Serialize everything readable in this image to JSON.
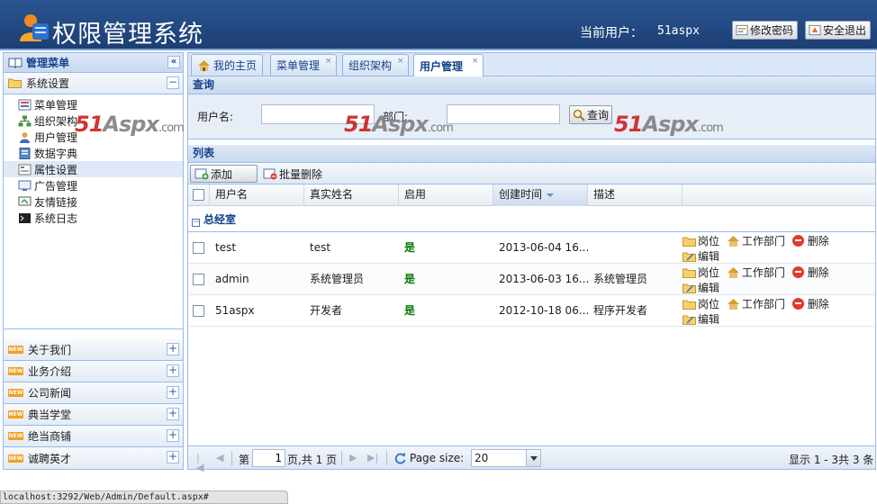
{
  "header": {
    "title": "权限管理系统",
    "current_user_label": "当前用户：",
    "current_user": "51aspx",
    "change_password": "修改密码",
    "logout": "安全退出"
  },
  "sidebar": {
    "title": "管理菜单",
    "collapse_symbol": "«",
    "expanded_group": "系统设置",
    "expanded_symbol": "−",
    "items": [
      {
        "label": "菜单管理",
        "icon": "menu-icon"
      },
      {
        "label": "组织架构",
        "icon": "org-chart-icon"
      },
      {
        "label": "用户管理",
        "icon": "user-icon"
      },
      {
        "label": "数据字典",
        "icon": "dictionary-icon"
      },
      {
        "label": "属性设置",
        "icon": "property-icon"
      },
      {
        "label": "广告管理",
        "icon": "ad-icon"
      },
      {
        "label": "友情链接",
        "icon": "link-icon"
      },
      {
        "label": "系统日志",
        "icon": "log-icon"
      }
    ],
    "new_badge": "NEW",
    "collapsed_symbol": "+",
    "collapsed_groups": [
      "关于我们",
      "业务介绍",
      "公司新闻",
      "典当学堂",
      "绝当商铺",
      "诚聘英才"
    ]
  },
  "tabs": [
    {
      "label": "我的主页",
      "icon": "home-icon",
      "closable": false
    },
    {
      "label": "菜单管理",
      "closable": true
    },
    {
      "label": "组织架构",
      "closable": true
    },
    {
      "label": "用户管理",
      "closable": true,
      "active": true
    }
  ],
  "tab_close_symbol": "×",
  "query": {
    "title": "查询",
    "username_label": "用户名:",
    "username_value": "",
    "department_label": "部门:",
    "department_value": "",
    "search_button": "查询"
  },
  "list": {
    "title": "列表",
    "add_button": "添加",
    "batch_delete_button": "批量删除",
    "columns": [
      "用户名",
      "真实姓名",
      "启用",
      "创建时间",
      "描述"
    ],
    "sorted_column": "创建时间",
    "group": "总经室",
    "group_toggle": "−",
    "rows": [
      {
        "username": "test",
        "realname": "test",
        "enabled": "是",
        "created": "2013-06-04 16...",
        "description": ""
      },
      {
        "username": "admin",
        "realname": "系统管理员",
        "enabled": "是",
        "created": "2013-06-03 16...",
        "description": "系统管理员"
      },
      {
        "username": "51aspx",
        "realname": "开发者",
        "enabled": "是",
        "created": "2012-10-18 06...",
        "description": "程序开发者"
      }
    ],
    "actions": {
      "post": "岗位",
      "dept": "工作部门",
      "delete": "删除",
      "edit": "编辑"
    }
  },
  "pager": {
    "page_prefix": "第",
    "page_value": "1",
    "page_suffix": "页,共 1 页",
    "page_size_label": "Page size:",
    "page_size": "20",
    "summary": "显示 1 - 3共 3 条"
  },
  "watermark": {
    "number": "51",
    "brand": "Aspx",
    "suffix": ".com"
  },
  "statusbar": "localhost:3292/Web/Admin/Default.aspx#"
}
